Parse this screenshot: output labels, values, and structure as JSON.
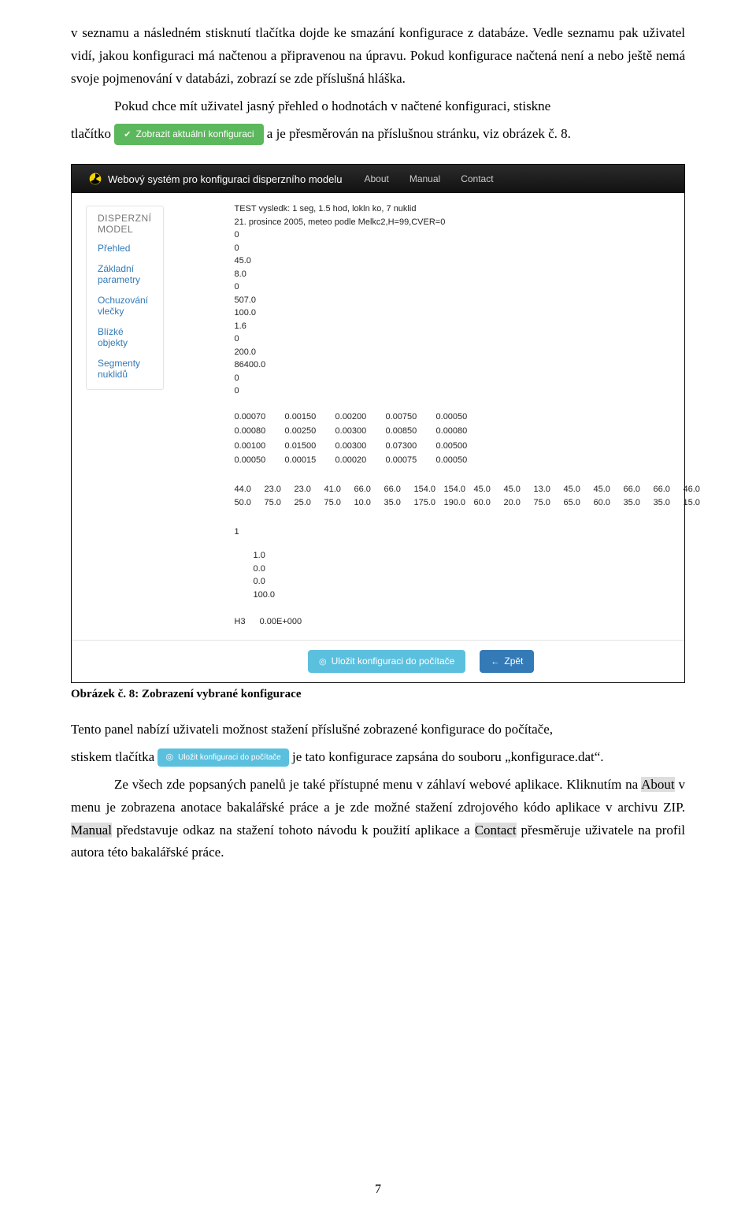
{
  "text": {
    "p1a": "v seznamu a následném stisknutí tlačítka dojde ke smazání konfigurace z databáze. Vedle seznamu pak uživatel vidí, jakou konfiguraci má načtenou a připravenou na úpravu. Pokud konfigurace načtená není a nebo ještě nemá svoje pojmenování v databázi, zobrazí se zde příslušná hláška.",
    "p1b": "Pokud chce mít uživatel jasný přehled o hodnotách v načtené konfiguraci, stiskne",
    "p1c_before_btn": "tlačítko ",
    "btn_view": "Zobrazit aktuální konfiguraci",
    "p1c_after_btn": " a je přesměrován na příslušnou stránku, viz obrázek č. 8.",
    "caption": "Obrázek č. 8: Zobrazení vybrané konfigurace",
    "p2a": "Tento panel nabízí uživateli možnost stažení příslušné zobrazené konfigurace do počítače,",
    "p2b_before_btn": "stiskem tlačítka ",
    "btn_dl": "Uložit konfiguraci do počítače",
    "p2b_after_btn": " je tato konfigurace zapsána do souboru „konfigurace.dat“.",
    "p3": "Ze všech zde popsaných panelů je také přístupné menu v záhlaví webové aplikace. Kliknutím na ",
    "p3_about": "About",
    "p3b": " v menu je zobrazena anotace bakalářské práce a je zde možné stažení zdrojového kódo aplikace v archivu ZIP. ",
    "p3_manual": "Manual",
    "p3c": " představuje odkaz na stažení tohoto návodu k použití aplikace a ",
    "p3_contact": "Contact",
    "p3d": " přesměruje uživatele na profil autora této bakalářské práce.",
    "page_num": "7"
  },
  "shot": {
    "brand": "Webový systém pro konfiguraci disperzního modelu",
    "nav": {
      "about": "About",
      "manual": "Manual",
      "contact": "Contact"
    },
    "sidebar": {
      "heading": "DISPERZNÍ MODEL",
      "items": [
        "Přehled",
        "Základní parametry",
        "Ochuzování vlečky",
        "Blízké objekty",
        "Segmenty nuklidů"
      ]
    },
    "main": {
      "line1": "TEST vysledk: 1 seg, 1.5 hod, lokln ko, 7 nuklid",
      "line2": "21. prosince 2005, meteo podle Melkc2,H=99,CVER=0",
      "col": [
        "0",
        "0",
        "45.0",
        "8.0",
        "0",
        "507.0",
        "100.0",
        "1.6",
        "0",
        "200.0",
        "86400.0",
        "0",
        "0"
      ],
      "grid5": [
        [
          "0.00070",
          "0.00150",
          "0.00200",
          "0.00750",
          "0.00050"
        ],
        [
          "0.00080",
          "0.00250",
          "0.00300",
          "0.00850",
          "0.00080"
        ],
        [
          "0.00100",
          "0.01500",
          "0.00300",
          "0.07300",
          "0.00500"
        ],
        [
          "0.00050",
          "0.00015",
          "0.00020",
          "0.00075",
          "0.00050"
        ]
      ],
      "wide": [
        [
          "44.0",
          "23.0",
          "23.0",
          "41.0",
          "66.0",
          "66.0",
          "154.0",
          "154.0",
          "45.0",
          "45.0",
          "13.0",
          "45.0",
          "45.0",
          "66.0",
          "66.0",
          "46.0"
        ],
        [
          "50.0",
          "75.0",
          "25.0",
          "75.0",
          "10.0",
          "35.0",
          "175.0",
          "190.0",
          "60.0",
          "20.0",
          "75.0",
          "65.0",
          "60.0",
          "35.0",
          "35.0",
          "15.0"
        ]
      ],
      "single": "1",
      "col2": [
        "1.0",
        "0.0",
        "0.0",
        "100.0"
      ],
      "last": [
        "H3",
        "0.00E+000"
      ]
    },
    "footer": {
      "save": "Uložit konfiguraci do počítače",
      "back": "Zpět"
    }
  }
}
